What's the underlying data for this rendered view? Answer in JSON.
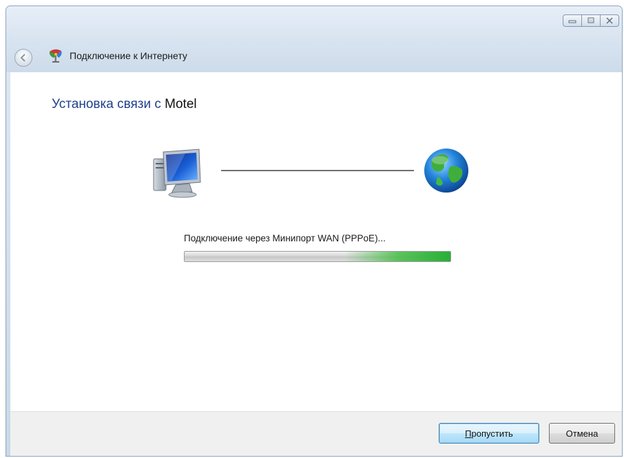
{
  "window": {
    "title": "Подключение к Интернету",
    "controls": {
      "minimize": "minimize-icon",
      "maximize": "maximize-icon",
      "close": "close-icon"
    }
  },
  "content": {
    "heading_prefix": "Установка связи с",
    "heading_name": "Motel",
    "status": "Подключение через Минипорт WAN (PPPoE)...",
    "progress": {
      "state": "indeterminate",
      "accent_color": "#3cb44a"
    },
    "icons": {
      "left": "computer-icon",
      "right": "globe-icon"
    }
  },
  "buttons": {
    "skip_label": "Пропустить",
    "skip_mnemonic": "П",
    "skip_rest": "ропустить",
    "cancel_label": "Отмена"
  }
}
